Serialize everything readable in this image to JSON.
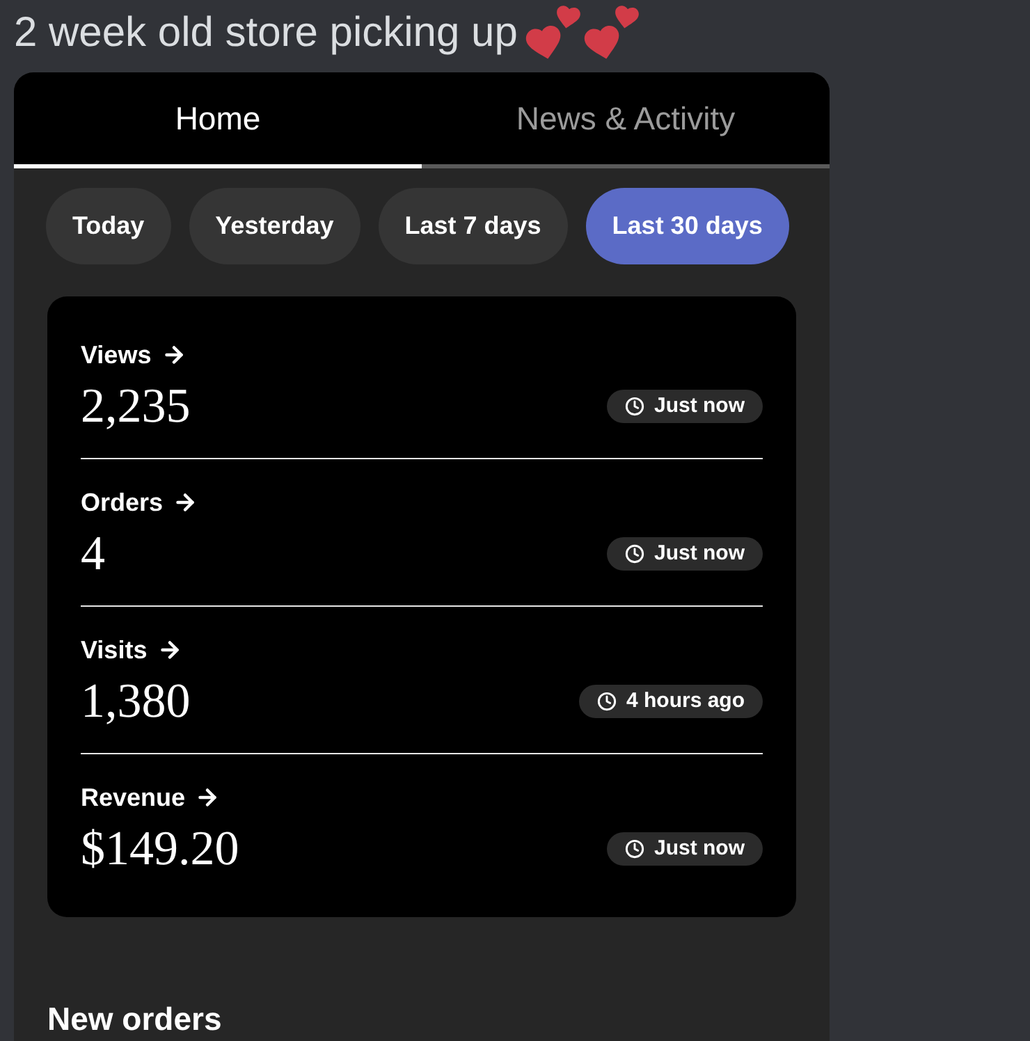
{
  "message": {
    "text": "2 week old store picking up"
  },
  "tabs": [
    {
      "label": "Home",
      "selected": true
    },
    {
      "label": "News & Activity",
      "selected": false
    }
  ],
  "date_ranges": [
    {
      "label": "Today",
      "selected": false
    },
    {
      "label": "Yesterday",
      "selected": false
    },
    {
      "label": "Last 7 days",
      "selected": false
    },
    {
      "label": "Last 30 days",
      "selected": true
    }
  ],
  "stats": [
    {
      "label": "Views",
      "value": "2,235",
      "updated": "Just now"
    },
    {
      "label": "Orders",
      "value": "4",
      "updated": "Just now"
    },
    {
      "label": "Visits",
      "value": "1,380",
      "updated": "4 hours ago"
    },
    {
      "label": "Revenue",
      "value": "$149.20",
      "updated": "Just now"
    }
  ],
  "section_title": "New orders"
}
